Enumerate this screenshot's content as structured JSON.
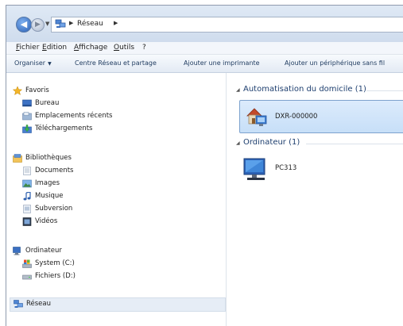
{
  "address": {
    "path": "Réseau"
  },
  "menu": [
    "Fichier",
    "Edition",
    "Affichage",
    "Outils",
    "?"
  ],
  "toolbar": {
    "organize": "Organiser",
    "network_center": "Centre Réseau et partage",
    "add_printer": "Ajouter une imprimante",
    "add_device": "Ajouter un périphérique sans fil"
  },
  "sidebar": {
    "favorites": {
      "label": "Favoris",
      "items": [
        "Bureau",
        "Emplacements récents",
        "Téléchargements"
      ]
    },
    "libraries": {
      "label": "Bibliothèques",
      "items": [
        "Documents",
        "Images",
        "Musique",
        "Subversion",
        "Vidéos"
      ]
    },
    "computer": {
      "label": "Ordinateur",
      "items": [
        "System (C:)",
        "Fichiers (D:)"
      ]
    },
    "network": {
      "label": "Réseau"
    }
  },
  "content": {
    "groups": [
      {
        "header": "Automatisation du domicile (1)",
        "items": [
          {
            "name": "DXR-000000",
            "icon": "home-automation-device-icon",
            "selected": true
          }
        ]
      },
      {
        "header": "Ordinateur (1)",
        "items": [
          {
            "name": "PC313",
            "icon": "computer-monitor-icon",
            "selected": false
          }
        ]
      }
    ]
  },
  "colors": {
    "accent": "#2a5fb4",
    "selection": "#cfe3fa",
    "group_header": "#1e3f6f"
  }
}
